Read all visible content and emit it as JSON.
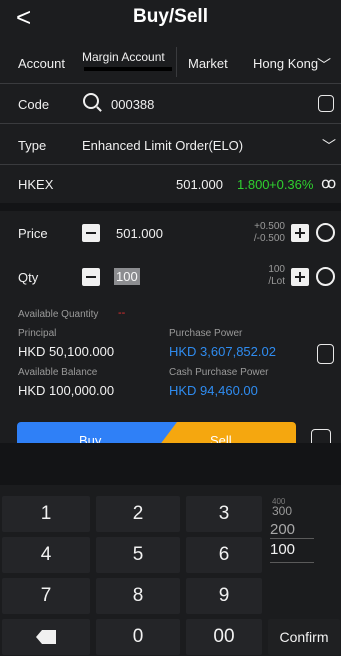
{
  "header": {
    "back": "<",
    "title": "Buy/Sell"
  },
  "account": {
    "label": "Account",
    "value": "Margin Account",
    "market_label": "Market",
    "market_value": "Hong Kong"
  },
  "code": {
    "label": "Code",
    "value": "000388"
  },
  "type": {
    "label": "Type",
    "value": "Enhanced Limit Order(ELO)"
  },
  "quote": {
    "exchange": "HKEX",
    "price": "501.000",
    "change": "1.800",
    "percent": "+0.36%"
  },
  "price": {
    "label": "Price",
    "value": "501.000",
    "step_up": "+0.500",
    "step_down": "/-0.500"
  },
  "qty": {
    "label": "Qty",
    "value": "100",
    "lot": "100",
    "lot_unit": "/Lot"
  },
  "available": {
    "label": "Available Quantity",
    "value": "--"
  },
  "principal": {
    "label": "Principal",
    "value": "HKD 50,100.000"
  },
  "purchase_power": {
    "label": "Purchase Power",
    "value": "HKD 3,607,852.02"
  },
  "available_balance": {
    "label": "Available Balance",
    "value": "HKD 100,000.00"
  },
  "cash_purchase_power": {
    "label": "Cash Purchase Power",
    "value": "HKD 94,460.00"
  },
  "actions": {
    "buy": "Buy",
    "sell": "Sell"
  },
  "keypad": {
    "keys": [
      "1",
      "2",
      "3",
      "4",
      "5",
      "6",
      "7",
      "8",
      "9",
      "0",
      "00"
    ],
    "suggest": [
      "400",
      "300",
      "200",
      "100"
    ],
    "confirm": "Confirm"
  }
}
